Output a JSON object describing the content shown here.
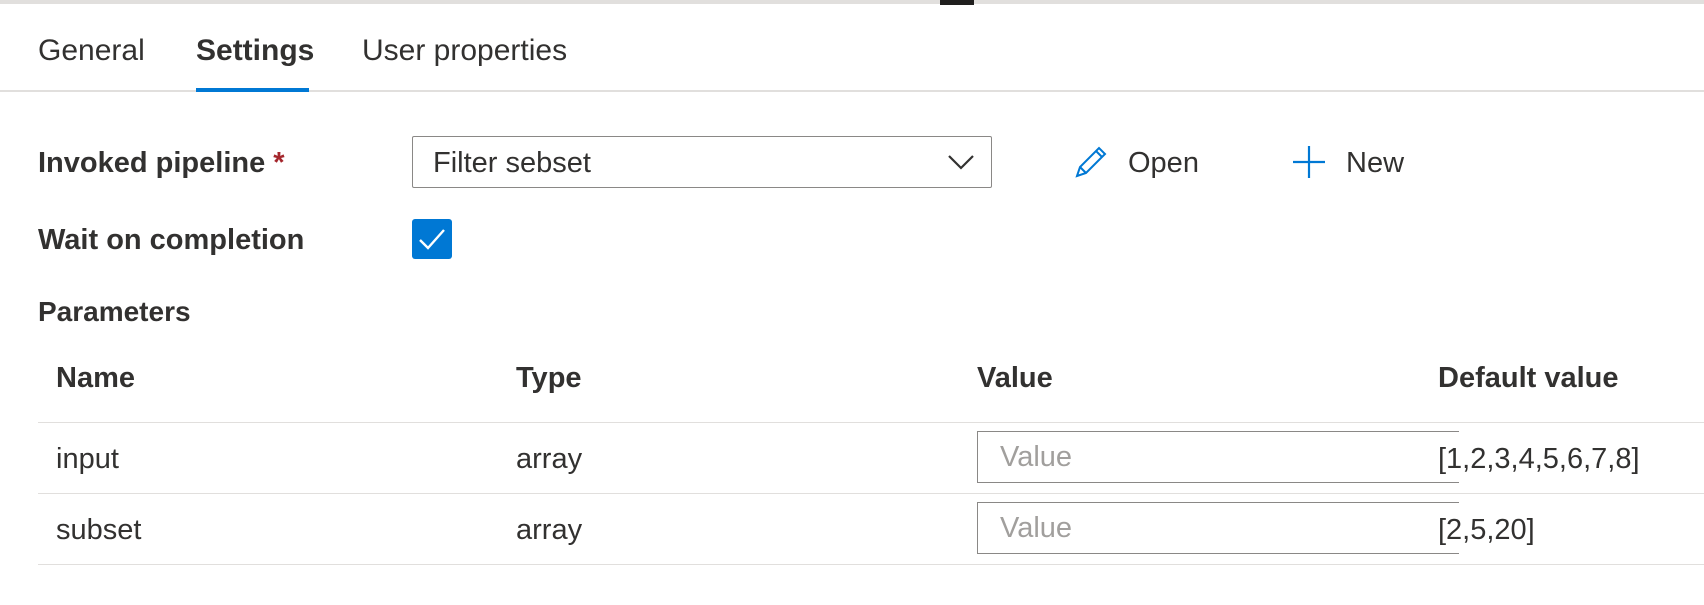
{
  "tabs": [
    {
      "label": "General",
      "active": false
    },
    {
      "label": "Settings",
      "active": true
    },
    {
      "label": "User properties",
      "active": false
    }
  ],
  "form": {
    "invoked_pipeline_label": "Invoked pipeline",
    "required_marker": "*",
    "invoked_pipeline_value": "Filter sebset",
    "open_label": "Open",
    "new_label": "New",
    "wait_label": "Wait on completion",
    "wait_checked": true
  },
  "parameters": {
    "title": "Parameters",
    "columns": [
      "Name",
      "Type",
      "Value",
      "Default value"
    ],
    "rows": [
      {
        "name": "input",
        "type": "array",
        "value": "",
        "value_placeholder": "Value",
        "default": "[1,2,3,4,5,6,7,8]"
      },
      {
        "name": "subset",
        "type": "array",
        "value": "",
        "value_placeholder": "Value",
        "default": "[2,5,20]"
      }
    ]
  },
  "colors": {
    "accent": "#0078d4",
    "required": "#a4262c",
    "text": "#323130",
    "border": "#8a8886",
    "divider": "#e1dfdd",
    "placeholder": "#a19f9d"
  },
  "icons": {
    "select_chevron": "chevron-down-icon",
    "open": "pencil-icon",
    "new": "plus-icon",
    "checkbox": "checkmark-icon"
  }
}
